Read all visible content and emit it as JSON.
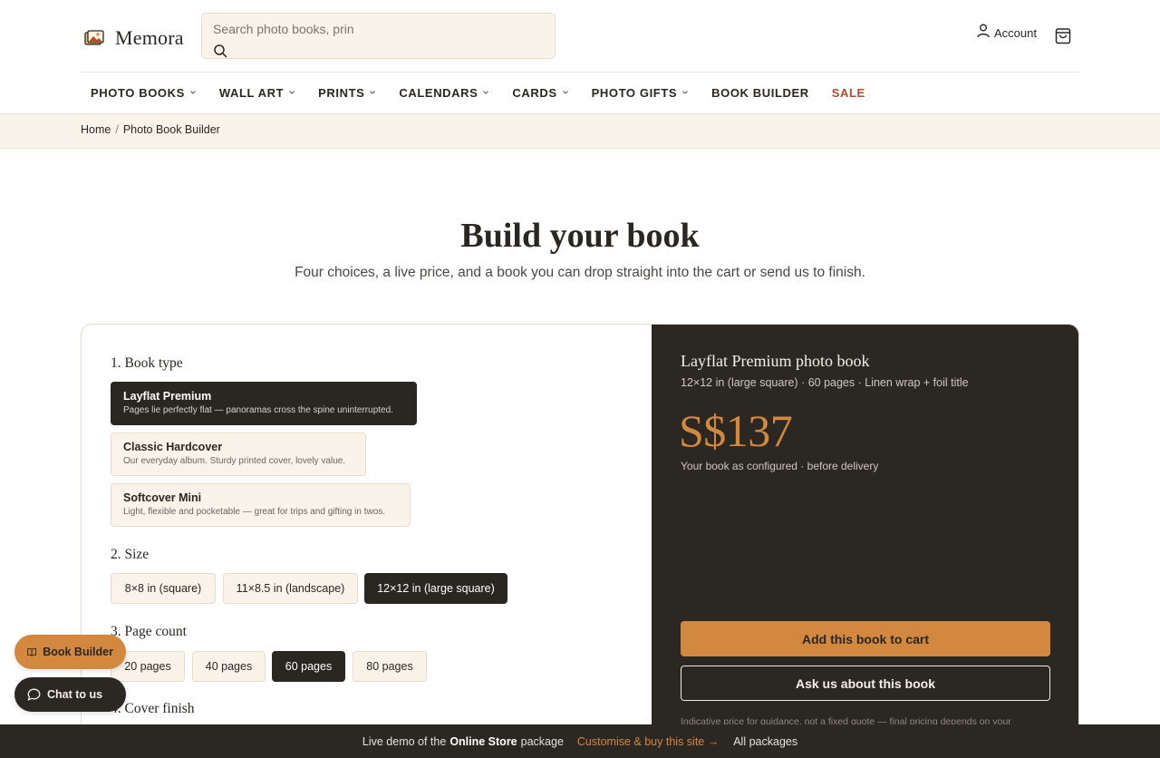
{
  "brand": {
    "name": "Memora"
  },
  "search": {
    "placeholder": "Search photo books, prin"
  },
  "header": {
    "account_label": "Account"
  },
  "nav": {
    "items": [
      {
        "label": "PHOTO BOOKS",
        "has_dropdown": true
      },
      {
        "label": "WALL ART",
        "has_dropdown": true
      },
      {
        "label": "PRINTS",
        "has_dropdown": true
      },
      {
        "label": "CALENDARS",
        "has_dropdown": true
      },
      {
        "label": "CARDS",
        "has_dropdown": true
      },
      {
        "label": "PHOTO GIFTS",
        "has_dropdown": true
      },
      {
        "label": "BOOK BUILDER",
        "has_dropdown": false
      },
      {
        "label": "SALE",
        "has_dropdown": false
      }
    ]
  },
  "breadcrumb": {
    "home": "Home",
    "separator": "/",
    "current": "Photo Book Builder"
  },
  "hero": {
    "title": "Build your book",
    "subtitle": "Four choices, a live price, and a book you can drop straight into the cart or send us to finish."
  },
  "builder": {
    "steps": {
      "book_type": "1. Book type",
      "size": "2. Size",
      "page_count": "3. Page count",
      "cover_finish": "4. Cover finish"
    },
    "book_types": [
      {
        "name": "Layflat Premium",
        "desc": "Pages lie perfectly flat — panoramas cross the spine uninterrupted.",
        "selected": true
      },
      {
        "name": "Classic Hardcover",
        "desc": "Our everyday album. Sturdy printed cover, lovely value.",
        "selected": false
      },
      {
        "name": "Softcover Mini",
        "desc": "Light, flexible and pocketable — great for trips and gifting in twos.",
        "selected": false
      }
    ],
    "sizes": [
      {
        "label": "8×8 in (square)",
        "selected": false
      },
      {
        "label": "11×8.5 in (landscape)",
        "selected": false
      },
      {
        "label": "12×12 in (large square)",
        "selected": true
      }
    ],
    "page_counts": [
      {
        "label": "20 pages",
        "selected": false
      },
      {
        "label": "40 pages",
        "selected": false
      },
      {
        "label": "60 pages",
        "selected": true
      },
      {
        "label": "80 pages",
        "selected": false
      }
    ]
  },
  "summary": {
    "title": "Layflat Premium photo book",
    "spec": "12×12 in (large square) · 60 pages · Linen wrap + foil title",
    "price": "S$137",
    "note": "Your book as configured · before delivery",
    "add_to_cart": "Add this book to cart",
    "ask": "Ask us about this book",
    "disclaimer": "Indicative price for guidance, not a fixed quote — final pricing depends on your"
  },
  "floating": {
    "builder_label": "Book Builder",
    "chat_label": "Chat to us"
  },
  "bottom_bar": {
    "pre": "Live demo of the",
    "package": "Online Store",
    "post": "package",
    "customise": "Customise & buy this site →",
    "all": "All packages"
  },
  "colors": {
    "accent": "#d2883f",
    "dark": "#2b2723",
    "cream": "#f9f3ea",
    "sale": "#b0492d"
  }
}
